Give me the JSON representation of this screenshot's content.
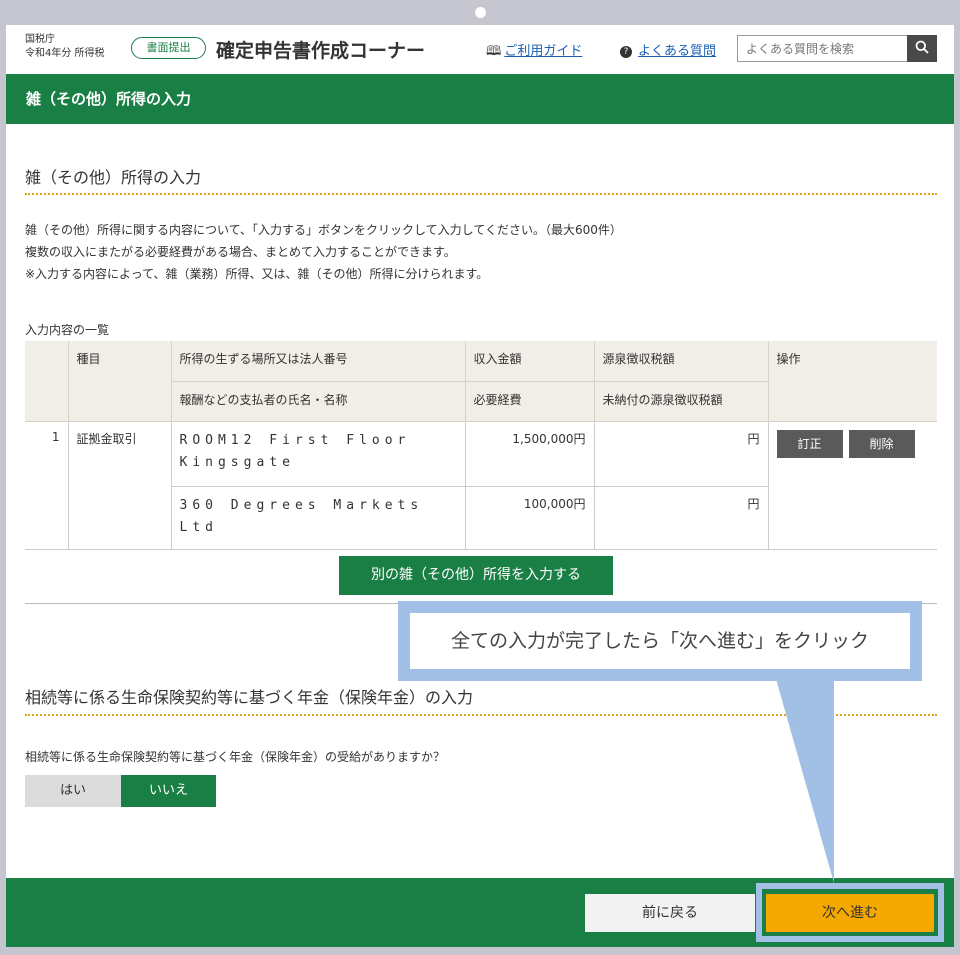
{
  "header": {
    "agency": "国税庁",
    "year_tax": "令和4年分 所得税",
    "badge": "書面提出",
    "title": "確定申告書作成コーナー",
    "guide_link": "ご利用ガイド",
    "faq_link": "よくある質問",
    "search_placeholder": "よくある質問を検索"
  },
  "page_title": "雑（その他）所得の入力",
  "section1": {
    "title": "雑（その他）所得の入力",
    "desc": [
      "雑（その他）所得に関する内容について、「入力する」ボタンをクリックして入力してください。（最大600件）",
      "複数の収入にまたがる必要経費がある場合、まとめて入力することができます。",
      "※入力する内容によって、雑（業務）所得、又は、雑（その他）所得に分けられます。"
    ],
    "list_label": "入力内容の一覧",
    "table": {
      "headers": {
        "kind": "種目",
        "place": "所得の生ずる場所又は法人番号",
        "payer": "報酬などの支払者の氏名・名称",
        "income": "収入金額",
        "expense": "必要経費",
        "withholding": "源泉徴収税額",
        "unpaid_withholding": "未納付の源泉徴収税額",
        "ops": "操作"
      },
      "row": {
        "no": "1",
        "kind": "証拠金取引",
        "place": "ROOM12 First Floor Kingsgate",
        "payer": "360 Degrees Markets Ltd",
        "income": "1,500,000円",
        "expense": "100,000円",
        "withholding": "円",
        "unpaid_withholding": "円",
        "edit": "訂正",
        "delete": "削除"
      }
    },
    "add_button": "別の雑（その他）所得を入力する"
  },
  "section2": {
    "title": "相続等に係る生命保険契約等に基づく年金（保険年金）の入力",
    "question": "相続等に係る生命保険契約等に基づく年金（保険年金）の受給がありますか？",
    "yes": "はい",
    "no": "いいえ",
    "selected": "いいえ"
  },
  "callout": "全ての入力が完了したら「次へ進む」をクリック",
  "footer": {
    "back": "前に戻る",
    "next": "次へ進む"
  },
  "colors": {
    "brand_green": "#1a7f45",
    "next_orange": "#f4a800",
    "callout_blue": "#a2bfe6"
  }
}
